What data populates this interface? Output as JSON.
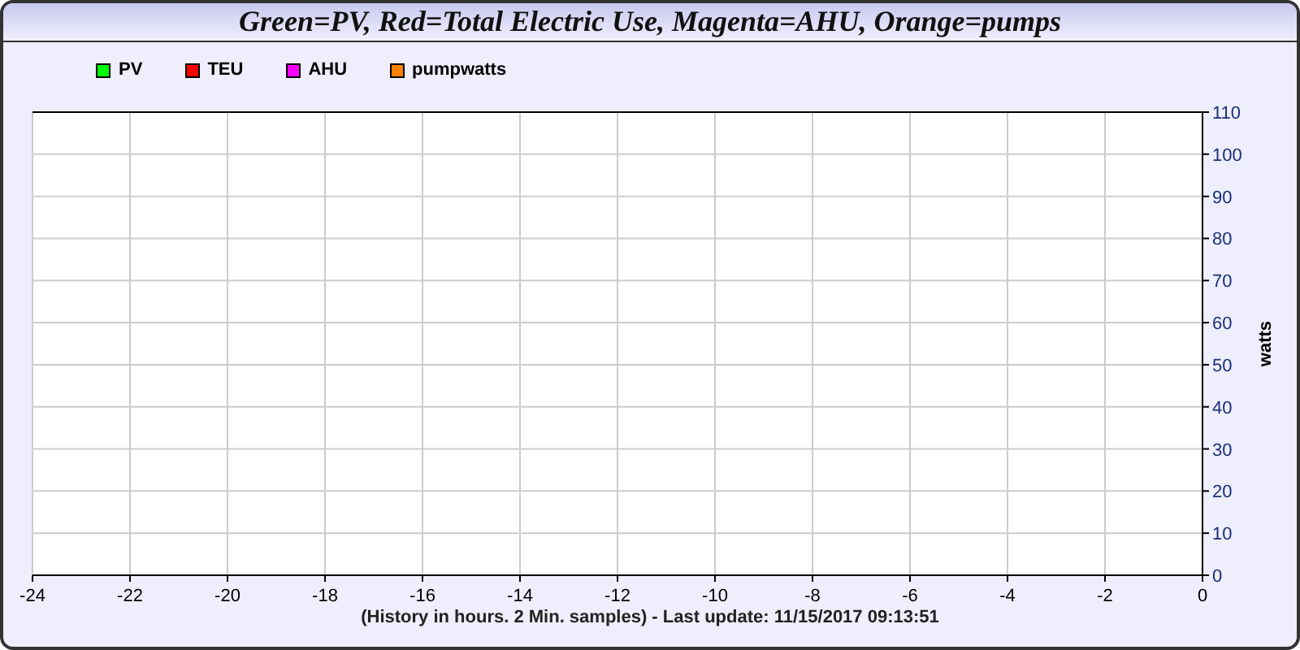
{
  "window": {
    "title": "Green=PV, Red=Total Electric Use, Magenta=AHU, Orange=pumps"
  },
  "chart": {
    "chart_data": {
      "type": "line",
      "ylabel": "watts",
      "grid": true,
      "ylim": [
        0,
        110
      ],
      "categories": [
        "-24",
        "-22",
        "-20",
        "-18",
        "-16",
        "-14",
        "-12",
        "-10",
        "-8",
        "-6",
        "-4",
        "-2",
        "0"
      ],
      "series": [
        {
          "name": "PV",
          "color": "#00ff00",
          "values": [
            null,
            null,
            null,
            null,
            null,
            null,
            null,
            null,
            null,
            null,
            null,
            null,
            null
          ]
        },
        {
          "name": "TEU",
          "color": "#ff0000",
          "values": [
            null,
            null,
            null,
            null,
            null,
            null,
            null,
            null,
            null,
            null,
            null,
            null,
            null
          ]
        },
        {
          "name": "AHU",
          "color": "#ff00ff",
          "values": [
            null,
            null,
            null,
            null,
            null,
            null,
            null,
            null,
            null,
            null,
            null,
            null,
            null
          ]
        },
        {
          "name": "pumpwatts",
          "color": "#ff8000",
          "values": [
            null,
            null,
            null,
            null,
            null,
            null,
            null,
            null,
            null,
            null,
            null,
            null,
            null
          ]
        }
      ],
      "yticks": [
        0,
        10,
        20,
        30,
        40,
        50,
        60,
        70,
        80,
        90,
        100,
        110
      ]
    },
    "footer": "(History in hours. 2 Min. samples) - Last update: 11/15/2017 09:13:51"
  }
}
